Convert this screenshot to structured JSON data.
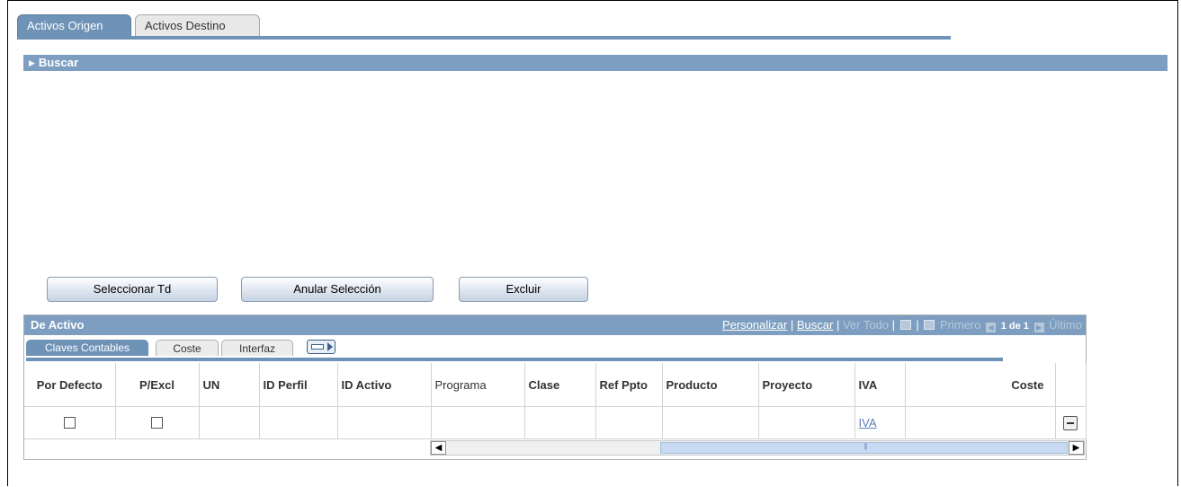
{
  "tabs": [
    {
      "label": "Activos Origen",
      "active": true
    },
    {
      "label": "Activos Destino",
      "active": false
    }
  ],
  "search": {
    "label": "Buscar"
  },
  "buttons": {
    "select_all": "Seleccionar Td",
    "deselect": "Anular Selección",
    "exclude": "Excluir"
  },
  "grid": {
    "title": "De Activo",
    "nav": {
      "personalizar": "Personalizar",
      "separator": "|",
      "buscar": "Buscar",
      "ver_todo": "Ver Todo",
      "primero": "Primero",
      "range": "1 de 1",
      "ultimo": "Último"
    },
    "subtabs": [
      "Claves Contables",
      "Coste",
      "Interfaz"
    ],
    "columns": [
      "Por Defecto",
      "P/Excl",
      "UN",
      "ID Perfil",
      "ID Activo",
      "Programa",
      "Clase",
      "Ref Ppto",
      "Producto",
      "Proyecto",
      "IVA",
      "Coste"
    ],
    "row": {
      "iva_link": "IVA"
    }
  },
  "colors": {
    "header_blue": "#7d9ec0",
    "tab_active": "#6f93b7",
    "link": "#5b7fb3"
  }
}
